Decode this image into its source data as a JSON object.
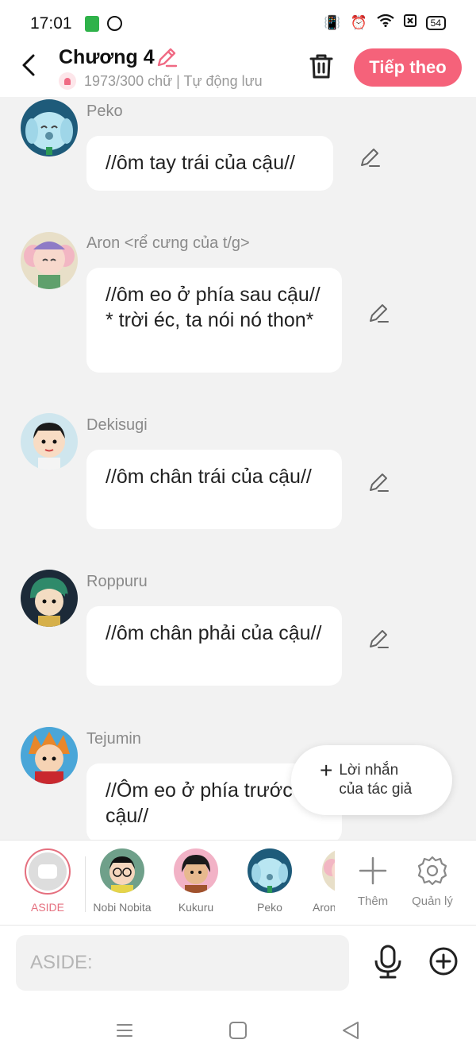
{
  "status_bar": {
    "time": "17:01",
    "battery": "54"
  },
  "header": {
    "title": "Chương 4",
    "subtitle": "1973/300 chữ | Tự động lưu",
    "next_label": "Tiếp theo"
  },
  "messages": [
    {
      "sender": "Peko",
      "text": "//ôm tay trái của cậu//"
    },
    {
      "sender": "Aron <rể cưng của t/g>",
      "text": "//ôm eo ở phía sau cậu// * trời éc, ta nói nó thon*"
    },
    {
      "sender": "Dekisugi",
      "text": "//ôm chân trái của cậu//"
    },
    {
      "sender": "Roppuru",
      "text": "//ôm chân phải của cậu//"
    },
    {
      "sender": "Tejumin",
      "text": "//Ôm eo ở phía trước cậu//"
    }
  ],
  "fab": {
    "label": "Lời nhắn của tác giả"
  },
  "characters": [
    {
      "name": "ASIDE"
    },
    {
      "name": "Nobi Nobita"
    },
    {
      "name": "Kukuru"
    },
    {
      "name": "Peko"
    },
    {
      "name": "Aron"
    }
  ],
  "tools": {
    "add_label": "Thêm",
    "manage_label": "Quản lý"
  },
  "input": {
    "placeholder": "ASIDE:"
  },
  "colors": {
    "accent": "#f5627a",
    "aside_ring": "#e5707f"
  }
}
